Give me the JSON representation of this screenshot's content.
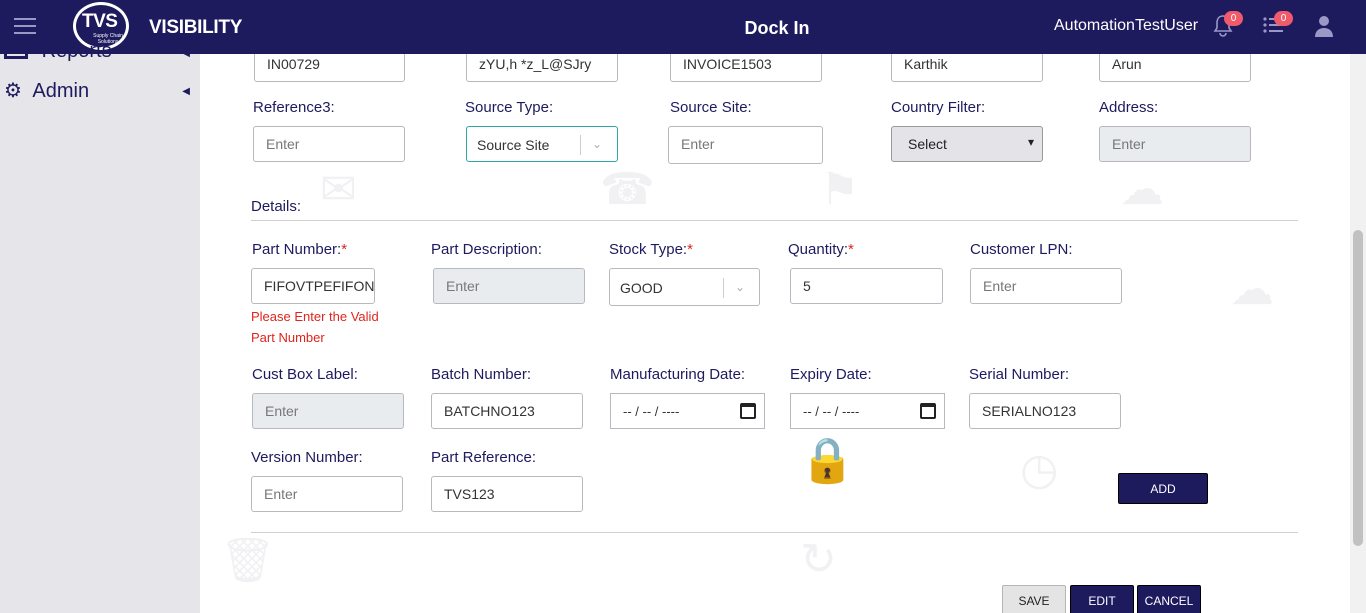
{
  "header": {
    "logo_text": "TVS",
    "logo_sub": "Supply Chain Solutions",
    "brand": "VISIBILITY",
    "page_title": "Dock In",
    "username": "AutomationTestUser",
    "notifications_count": "0",
    "tasks_count": "0"
  },
  "sidebar": {
    "items": [
      {
        "label": "Reports",
        "icon": "report-icon"
      },
      {
        "label": "Admin",
        "icon": "gears-icon"
      }
    ]
  },
  "top_row": {
    "values": [
      "IN00729",
      "zYU,h *z_L@SJry",
      "INVOICE1503",
      "Karthik",
      "Arun"
    ]
  },
  "row2": {
    "reference3_label": "Reference3:",
    "reference3_placeholder": "Enter",
    "source_type_label": "Source Type:",
    "source_type_value": "Source Site",
    "source_site_label": "Source Site:",
    "source_site_placeholder": "Enter",
    "country_filter_label": "Country Filter:",
    "country_filter_value": "Select",
    "address_label": "Address:",
    "address_placeholder": "Enter"
  },
  "details": {
    "section_title": "Details:",
    "part_number_label": "Part Number:",
    "part_number_value": "FIFOVTPEFIFON",
    "part_number_error": "Please Enter the Valid Part Number",
    "part_description_label": "Part Description:",
    "part_description_placeholder": "Enter",
    "stock_type_label": "Stock Type:",
    "stock_type_value": "GOOD",
    "quantity_label": "Quantity:",
    "quantity_value": "5",
    "customer_lpn_label": "Customer LPN:",
    "customer_lpn_placeholder": "Enter",
    "cust_box_label_label": "Cust Box Label:",
    "cust_box_label_placeholder": "Enter",
    "batch_number_label": "Batch Number:",
    "batch_number_value": "BATCHNO123",
    "manufacturing_date_label": "Manufacturing Date:",
    "manufacturing_date_value": "-- / -- / ----",
    "expiry_date_label": "Expiry Date:",
    "expiry_date_value": "-- / -- / ----",
    "serial_number_label": "Serial Number:",
    "serial_number_value": "SERIALNO123",
    "version_number_label": "Version Number:",
    "version_number_placeholder": "Enter",
    "part_reference_label": "Part Reference:",
    "part_reference_value": "TVS123",
    "required_mark": "*"
  },
  "actions": {
    "add": "ADD",
    "save": "SAVE",
    "edit": "EDIT",
    "cancel": "CANCEL"
  },
  "colors": {
    "header_bg": "#1e1a5e",
    "label": "#1e1a5e",
    "error": "#e0241c",
    "focus": "#2ba8a8",
    "badge": "#f05a6a"
  }
}
